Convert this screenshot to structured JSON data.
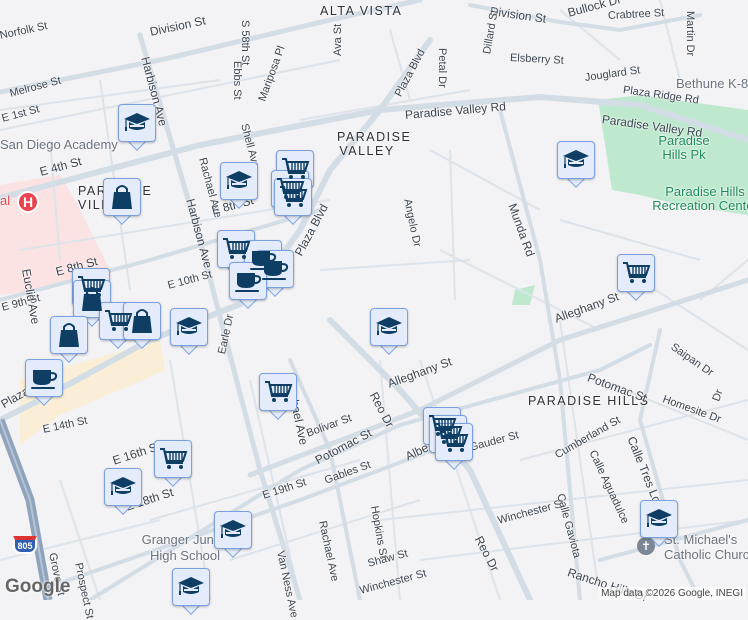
{
  "areas": [
    "ALTA VISTA",
    "PARADISE VALLEY",
    "PARADISE VILLAGE",
    "PARADISE HILLS"
  ],
  "streets": [
    "Division St",
    "Division St",
    "Bullock Dr",
    "Crabtree St",
    "Elsberry St",
    "Jouglard St",
    "Plaza Ridge Rd",
    "Paradise Valley Rd",
    "Paradise Valley Rd",
    "Plaza Blvd",
    "Petal Dr",
    "Dillard St",
    "S 58th St",
    "Mariposa Pl",
    "Ebbs St",
    "Ava St",
    "Shell Ave",
    "Harbison Ave",
    "Harbison Ave",
    "Rachael Ave",
    "E 8th St",
    "E 8th St",
    "E 10th St",
    "E 9th St",
    "E 4th St",
    "Melrose St",
    "E 1st St",
    "Euclid Ave",
    "Plaza Blvd",
    "Angelo Dr",
    "Munda Rd",
    "Alleghany St",
    "Alleghany St",
    "Earle Dr",
    "E 14th St",
    "E 16th St",
    "E 18th St",
    "E 19th St",
    "Bolivar St",
    "Potomac St",
    "Potomac St",
    "Gables St",
    "Reo Dr",
    "Reo Dr",
    "Rachael Ave",
    "Rachael Ave",
    "Van Ness Ave",
    "Hopkins St",
    "Shaw St",
    "Winchester St",
    "Winchester St",
    "Albe",
    "Gauder St",
    "Cumberland St",
    "Calle Aguadulce",
    "Calle Gaviota",
    "Calle Tres Lomas",
    "Saipan Dr",
    "Homesite Dr",
    "Rancho Hills Dr",
    "Grove St",
    "Prospect St",
    "Norfolk St",
    "Plaza Blvd",
    "Dr",
    "Martin Dr"
  ],
  "pois": {
    "academy": "San Diego Academy",
    "bethune": "Bethune K-8",
    "park": "Paradise Hills Pk",
    "rec": "Paradise Hills Recreation Center",
    "granger": "Granger Junior High School",
    "church": "St. Michael's Catholic Church",
    "hospital": "al"
  },
  "highway": "805",
  "markers": [
    "school",
    "school",
    "cart",
    "cart",
    "cart",
    "bag",
    "cart",
    "cup",
    "cup",
    "cup",
    "cart",
    "bag",
    "bag",
    "cart",
    "bag",
    "school",
    "cup",
    "cart",
    "cart",
    "school",
    "school",
    "school",
    "school",
    "school",
    "cart",
    "cart",
    "cart",
    "cart",
    "school"
  ],
  "attribution": "Map data ©2026 Google, INEGI",
  "logo": "Google",
  "colors": {
    "road": "#d3dde6",
    "park": "#bfe9cf",
    "marker_bg": "#e4ecfc",
    "marker_border": "#7aa0e0",
    "icon": "#0e3e63",
    "hospital": "#e8434f"
  }
}
